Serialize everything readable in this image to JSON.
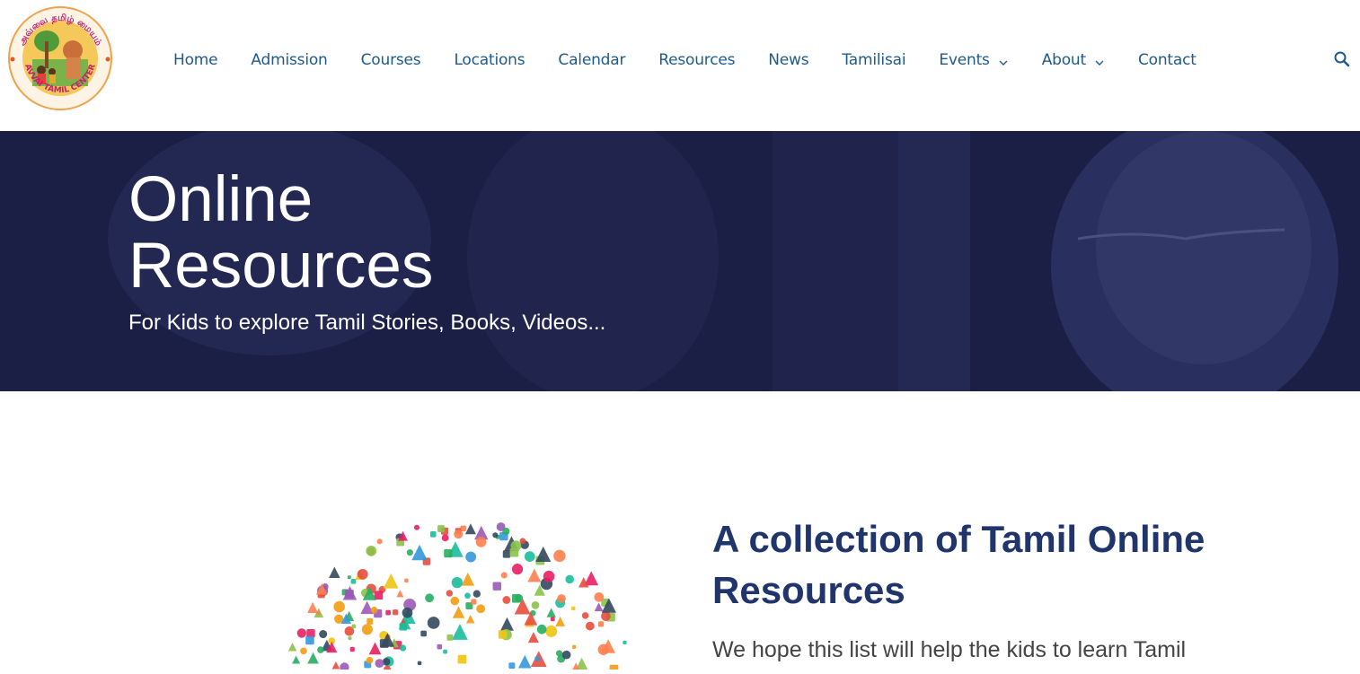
{
  "logo": {
    "text_top": "அவ்வை தமிழ் மையம்",
    "text_bottom": "AVVAI TAMIL CENTER"
  },
  "nav": {
    "items": [
      {
        "label": "Home",
        "dropdown": false
      },
      {
        "label": "Admission",
        "dropdown": false
      },
      {
        "label": "Courses",
        "dropdown": false
      },
      {
        "label": "Locations",
        "dropdown": false
      },
      {
        "label": "Calendar",
        "dropdown": false
      },
      {
        "label": "Resources",
        "dropdown": false
      },
      {
        "label": "News",
        "dropdown": false
      },
      {
        "label": "Tamilisai",
        "dropdown": false
      },
      {
        "label": "Events",
        "dropdown": true
      },
      {
        "label": "About",
        "dropdown": true
      },
      {
        "label": "Contact",
        "dropdown": false
      }
    ],
    "search_icon": "search-icon",
    "chevron_icon": "chevron-down-icon"
  },
  "hero": {
    "title_line1": "Online",
    "title_line2": "Resources",
    "subtitle": "For Kids to explore Tamil Stories, Books, Videos..."
  },
  "content": {
    "heading": "A collection of Tamil Online Resources",
    "paragraph": "We hope this list will help the kids to learn Tamil"
  },
  "colors": {
    "nav_text": "#1e5a8c",
    "hero_bg": "#1b1f45",
    "heading": "#20356b",
    "body_text": "#444444"
  }
}
